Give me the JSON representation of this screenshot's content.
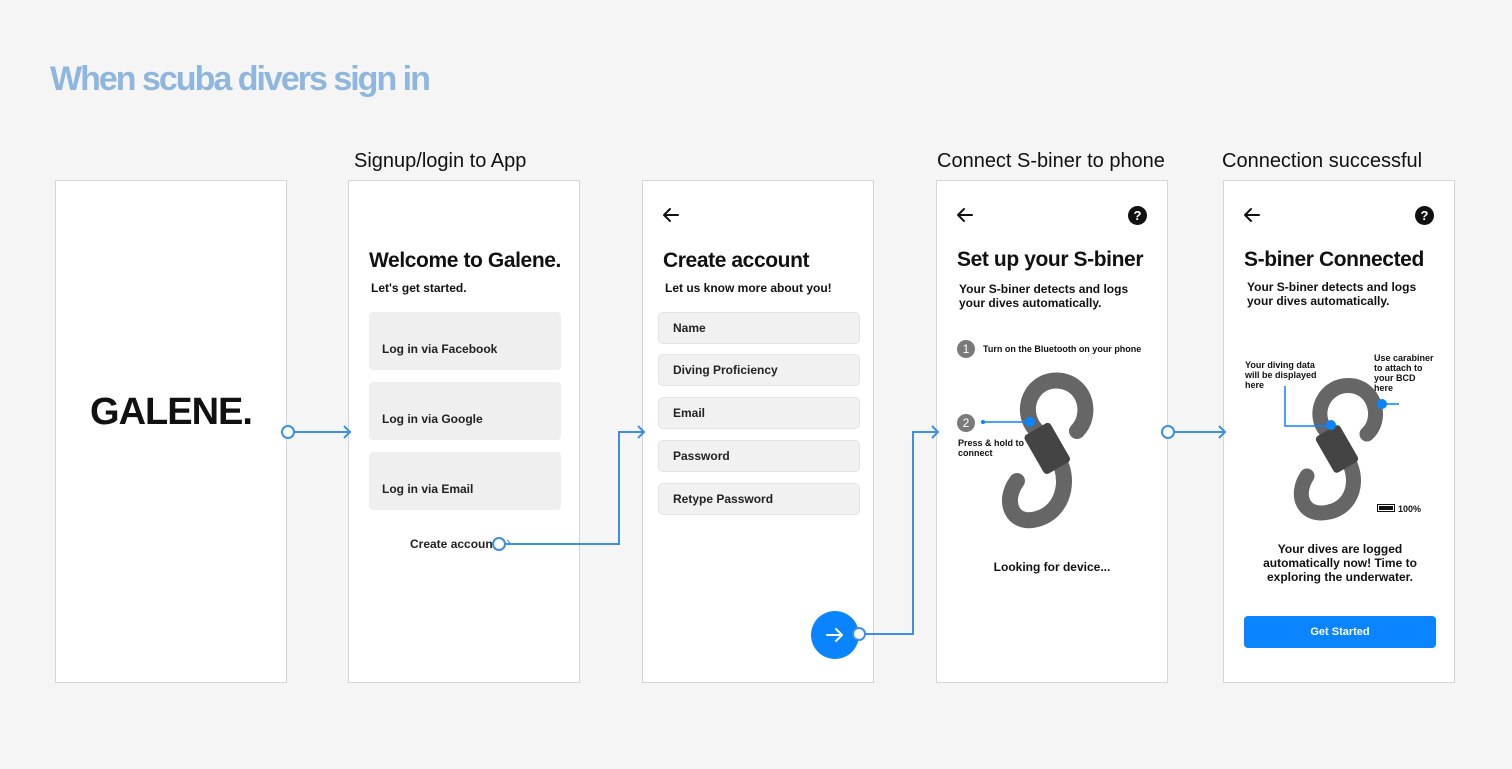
{
  "title": "When scuba divers sign in",
  "section_labels": {
    "signup": "Signup/login to App",
    "connect": "Connect S-biner to phone",
    "success": "Connection successful"
  },
  "splash": {
    "logo_text": "GALENE."
  },
  "welcome": {
    "heading": "Welcome to Galene.",
    "subheading": "Let's get started.",
    "buttons": [
      "Log in via Facebook",
      "Log in via Google",
      "Log in via Email"
    ],
    "create_account": "Create account"
  },
  "create_account": {
    "heading": "Create account",
    "subheading": "Let us know more about you!",
    "fields": [
      "Name",
      "Diving Proficiency",
      "Email",
      "Password",
      "Retype Password"
    ]
  },
  "setup": {
    "heading": "Set up your S-biner",
    "description": "Your S-biner detects and logs your dives automatically.",
    "step1_num": "1",
    "step1_text": "Turn on the Bluetooth on your phone",
    "step2_num": "2",
    "step2_text": "Press & hold to connect",
    "status": "Looking for device..."
  },
  "connected": {
    "heading": "S-biner Connected",
    "description": "Your S-biner detects and logs your dives automatically.",
    "annotation_left": "Your diving data will be displayed here",
    "annotation_right": "Use carabiner to attach to your BCD here",
    "battery": "100%",
    "message": "Your dives are logged automatically now! Time to exploring the underwater.",
    "button": "Get Started"
  },
  "colors": {
    "accent": "#0a84ff",
    "title": "#8fb6de",
    "connector": "#3b8fe8"
  }
}
